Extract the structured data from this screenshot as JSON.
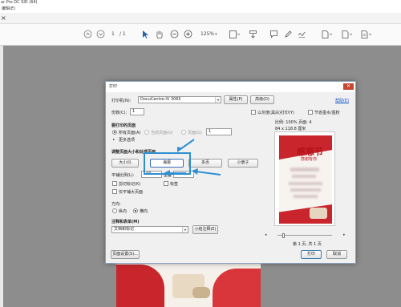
{
  "app": {
    "title": "ar Pro DC SID (64)",
    "menu": "编辑(E)",
    "tab_close": "×"
  },
  "toolbar": {
    "page_current": "1",
    "page_total": "/ 1",
    "zoom": "125%"
  },
  "dialog": {
    "title": "打印",
    "close": "✕",
    "help_link": "帮助(E)",
    "printer_label": "打印机(N):",
    "printer_value": "DocuCentre-IV 3065",
    "properties_btn": "属性(P)",
    "advanced_btn": "高级(D)",
    "copies_label": "份数(C):",
    "copies_value": "1",
    "grayscale_label": "以灰度(黑白)打印(Y)",
    "save_ink_label": "节省墨水/墨粉",
    "range_section": "要打印的页面",
    "range_all": "所有页面(A)",
    "range_current": "当前页面(U)",
    "range_pages": "页面(G)",
    "range_pages_value": "1",
    "more_options": "更多选项",
    "size_section": "调整页面大小和处理页面",
    "size_btn_size": "大小(I)",
    "size_btn_poster": "海报",
    "size_btn_multiple": "多页",
    "size_btn_booklet": "小册子",
    "tile_scale_label": "平铺比例(L):",
    "tile_scale_value": "100",
    "overlap_label": "重叠",
    "cut_marks": "剪切标记(K)",
    "labels": "标签",
    "tile_large_only": "仅平铺大页面",
    "orientation_section": "方向:",
    "orientation_portrait": "纵向",
    "orientation_landscape": "横向",
    "comments_section": "注释和表单(M)",
    "comments_value": "文档和标记",
    "summarize_btn": "小结注释(E)",
    "scale_info": "比例: 100% 页面: 4",
    "size_info": "84 x 118.8 厘米",
    "page_info": "第 1 页, 共 1 页",
    "page_setup_btn": "页面设置(S)...",
    "print_btn": "打印",
    "cancel_btn": "取消"
  },
  "preview": {
    "title_line1": "感恩节",
    "title_line2": "感谢有你"
  },
  "colors": {
    "accent_blue": "#2f8fd3",
    "poster_red": "#c8252d"
  }
}
